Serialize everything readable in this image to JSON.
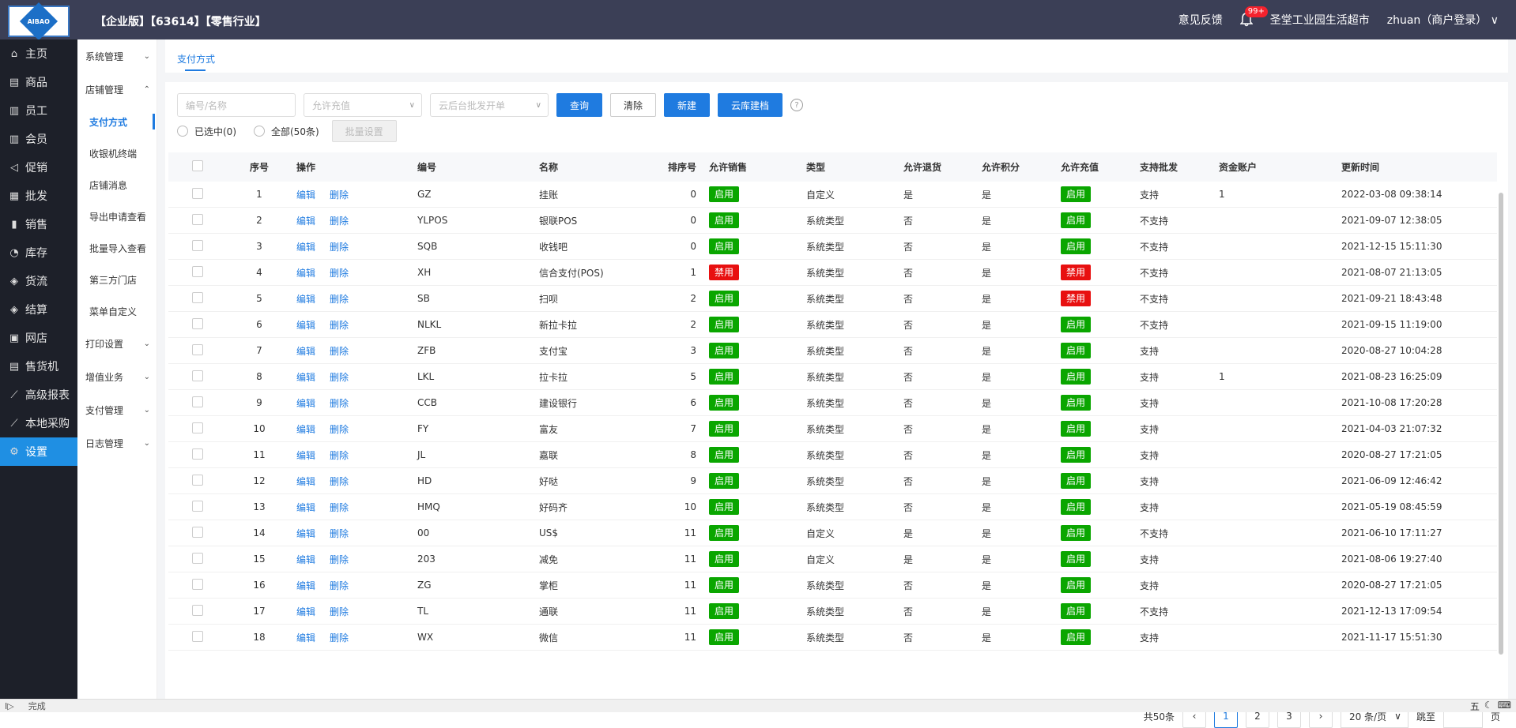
{
  "header": {
    "company": "【企业版】【63614】【零售行业】",
    "feedback": "意见反馈",
    "notify_count": "99+",
    "store": "圣堂工业园生活超市",
    "user": "zhuan（商户登录）",
    "logo_text": "AIBAO"
  },
  "leftnav": [
    {
      "label": "主页",
      "icon": "home-icon"
    },
    {
      "label": "商品",
      "icon": "goods-icon"
    },
    {
      "label": "员工",
      "icon": "staff-icon"
    },
    {
      "label": "会员",
      "icon": "member-icon"
    },
    {
      "label": "促销",
      "icon": "promo-icon"
    },
    {
      "label": "批发",
      "icon": "wholesale-icon"
    },
    {
      "label": "销售",
      "icon": "sales-icon"
    },
    {
      "label": "库存",
      "icon": "stock-icon"
    },
    {
      "label": "货流",
      "icon": "flow-icon"
    },
    {
      "label": "结算",
      "icon": "settle-icon"
    },
    {
      "label": "网店",
      "icon": "shop-icon"
    },
    {
      "label": "售货机",
      "icon": "vending-icon"
    },
    {
      "label": "高级报表",
      "icon": "report-icon"
    },
    {
      "label": "本地采购",
      "icon": "purchase-icon"
    },
    {
      "label": "设置",
      "icon": "gear-icon"
    }
  ],
  "subnav": {
    "system": "系统管理",
    "store": "店铺管理",
    "items": [
      "支付方式",
      "收银机终端",
      "店铺消息",
      "导出申请查看",
      "批量导入查看",
      "第三方门店",
      "菜单自定义"
    ],
    "print": "打印设置",
    "value_added": "增值业务",
    "payment": "支付管理",
    "log": "日志管理"
  },
  "tab": "支付方式",
  "filters": {
    "code_placeholder": "编号/名称",
    "recharge_placeholder": "允许充值",
    "cloud_placeholder": "云后台批发开单",
    "query": "查询",
    "clear": "清除",
    "new": "新建",
    "cloud_build": "云库建档",
    "selected": "已选中(0)",
    "all": "全部(50条)",
    "batch": "批量设置"
  },
  "columns": [
    "序号",
    "操作",
    "编号",
    "名称",
    "排序号",
    "允许销售",
    "类型",
    "允许退货",
    "允许积分",
    "允许充值",
    "支持批发",
    "资金账户",
    "更新时间"
  ],
  "actions": {
    "edit": "编辑",
    "delete": "删除"
  },
  "rows": [
    {
      "no": "1",
      "code": "GZ",
      "name": "挂账",
      "sort": "0",
      "sale": "启用",
      "type": "自定义",
      "ret": "是",
      "pts": "是",
      "chg": "启用",
      "bat": "支持",
      "acc": "1",
      "time": "2022-03-08 09:38:14"
    },
    {
      "no": "2",
      "code": "YLPOS",
      "name": "银联POS",
      "sort": "0",
      "sale": "启用",
      "type": "系统类型",
      "ret": "否",
      "pts": "是",
      "chg": "启用",
      "bat": "不支持",
      "acc": "",
      "time": "2021-09-07 12:38:05"
    },
    {
      "no": "3",
      "code": "SQB",
      "name": "收钱吧",
      "sort": "0",
      "sale": "启用",
      "type": "系统类型",
      "ret": "否",
      "pts": "是",
      "chg": "启用",
      "bat": "不支持",
      "acc": "",
      "time": "2021-12-15 15:11:30"
    },
    {
      "no": "4",
      "code": "XH",
      "name": "信合支付(POS)",
      "sort": "1",
      "sale": "禁用",
      "type": "系统类型",
      "ret": "否",
      "pts": "是",
      "chg": "禁用",
      "bat": "不支持",
      "acc": "",
      "time": "2021-08-07 21:13:05"
    },
    {
      "no": "5",
      "code": "SB",
      "name": "扫呗",
      "sort": "2",
      "sale": "启用",
      "type": "系统类型",
      "ret": "否",
      "pts": "是",
      "chg": "禁用",
      "bat": "不支持",
      "acc": "",
      "time": "2021-09-21 18:43:48"
    },
    {
      "no": "6",
      "code": "NLKL",
      "name": "新拉卡拉",
      "sort": "2",
      "sale": "启用",
      "type": "系统类型",
      "ret": "否",
      "pts": "是",
      "chg": "启用",
      "bat": "不支持",
      "acc": "",
      "time": "2021-09-15 11:19:00"
    },
    {
      "no": "7",
      "code": "ZFB",
      "name": "支付宝",
      "sort": "3",
      "sale": "启用",
      "type": "系统类型",
      "ret": "否",
      "pts": "是",
      "chg": "启用",
      "bat": "支持",
      "acc": "",
      "time": "2020-08-27 10:04:28"
    },
    {
      "no": "8",
      "code": "LKL",
      "name": "拉卡拉",
      "sort": "5",
      "sale": "启用",
      "type": "系统类型",
      "ret": "否",
      "pts": "是",
      "chg": "启用",
      "bat": "支持",
      "acc": "1",
      "time": "2021-08-23 16:25:09"
    },
    {
      "no": "9",
      "code": "CCB",
      "name": "建设银行",
      "sort": "6",
      "sale": "启用",
      "type": "系统类型",
      "ret": "否",
      "pts": "是",
      "chg": "启用",
      "bat": "支持",
      "acc": "",
      "time": "2021-10-08 17:20:28"
    },
    {
      "no": "10",
      "code": "FY",
      "name": "富友",
      "sort": "7",
      "sale": "启用",
      "type": "系统类型",
      "ret": "否",
      "pts": "是",
      "chg": "启用",
      "bat": "支持",
      "acc": "",
      "time": "2021-04-03 21:07:32"
    },
    {
      "no": "11",
      "code": "JL",
      "name": "嘉联",
      "sort": "8",
      "sale": "启用",
      "type": "系统类型",
      "ret": "否",
      "pts": "是",
      "chg": "启用",
      "bat": "支持",
      "acc": "",
      "time": "2020-08-27 17:21:05"
    },
    {
      "no": "12",
      "code": "HD",
      "name": "好哒",
      "sort": "9",
      "sale": "启用",
      "type": "系统类型",
      "ret": "否",
      "pts": "是",
      "chg": "启用",
      "bat": "支持",
      "acc": "",
      "time": "2021-06-09 12:46:42"
    },
    {
      "no": "13",
      "code": "HMQ",
      "name": "好码齐",
      "sort": "10",
      "sale": "启用",
      "type": "系统类型",
      "ret": "否",
      "pts": "是",
      "chg": "启用",
      "bat": "支持",
      "acc": "",
      "time": "2021-05-19 08:45:59"
    },
    {
      "no": "14",
      "code": "00",
      "name": "US$",
      "sort": "11",
      "sale": "启用",
      "type": "自定义",
      "ret": "是",
      "pts": "是",
      "chg": "启用",
      "bat": "不支持",
      "acc": "",
      "time": "2021-06-10 17:11:27"
    },
    {
      "no": "15",
      "code": "203",
      "name": "减免",
      "sort": "11",
      "sale": "启用",
      "type": "自定义",
      "ret": "是",
      "pts": "是",
      "chg": "启用",
      "bat": "支持",
      "acc": "",
      "time": "2021-08-06 19:27:40"
    },
    {
      "no": "16",
      "code": "ZG",
      "name": "掌柜",
      "sort": "11",
      "sale": "启用",
      "type": "系统类型",
      "ret": "否",
      "pts": "是",
      "chg": "启用",
      "bat": "支持",
      "acc": "",
      "time": "2020-08-27 17:21:05"
    },
    {
      "no": "17",
      "code": "TL",
      "name": "通联",
      "sort": "11",
      "sale": "启用",
      "type": "系统类型",
      "ret": "否",
      "pts": "是",
      "chg": "启用",
      "bat": "不支持",
      "acc": "",
      "time": "2021-12-13 17:09:54"
    },
    {
      "no": "18",
      "code": "WX",
      "name": "微信",
      "sort": "11",
      "sale": "启用",
      "type": "系统类型",
      "ret": "否",
      "pts": "是",
      "chg": "启用",
      "bat": "支持",
      "acc": "",
      "time": "2021-11-17 15:51:30"
    }
  ],
  "pager": {
    "total": "共50条",
    "pages": [
      "1",
      "2",
      "3"
    ],
    "page_size": "20 条/页",
    "jump": "跳至",
    "page_unit": "页"
  },
  "status": {
    "text": "完成",
    "ime": "五"
  },
  "colors": {
    "accent": "#1f7be0",
    "on": "#0aa600",
    "off": "#e81010",
    "topbar": "#3b3f56",
    "nav": "#1d2029"
  }
}
